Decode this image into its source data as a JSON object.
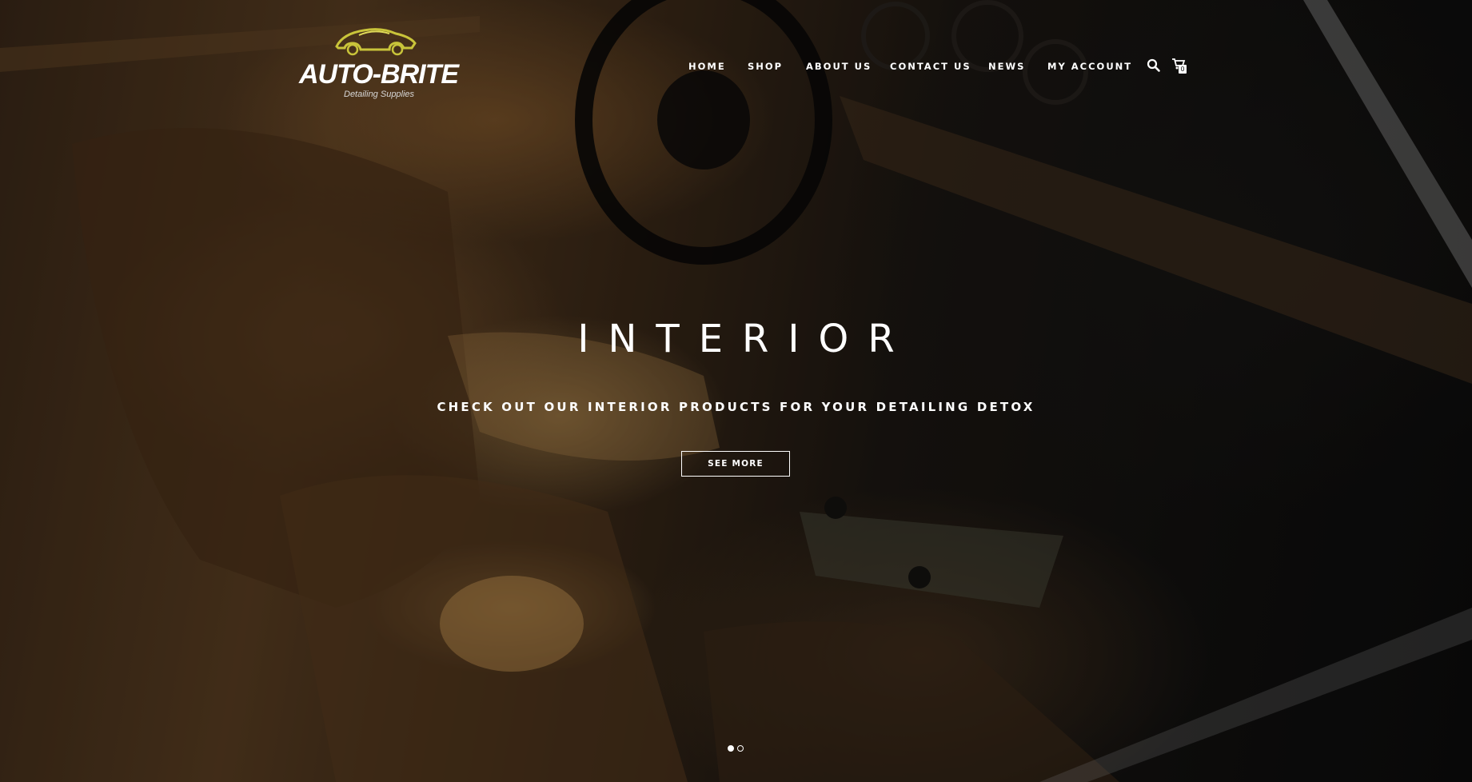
{
  "brand": {
    "name": "AUTO-BRITE",
    "tagline": "Detailing Supplies",
    "accent_color": "#c9c43a"
  },
  "nav": {
    "items": [
      {
        "label": "HOME"
      },
      {
        "label": "SHOP"
      },
      {
        "label": "ABOUT US"
      },
      {
        "label": "CONTACT US"
      },
      {
        "label": "NEWS"
      },
      {
        "label": "MY ACCOUNT"
      }
    ],
    "search_icon": "search-icon",
    "cart_icon": "cart-icon",
    "cart_count": "0"
  },
  "hero": {
    "title": "INTERIOR",
    "subtitle": "CHECK OUT OUR INTERIOR PRODUCTS FOR YOUR DETAILING DETOX",
    "button_label": "SEE MORE",
    "slides_total": 2,
    "active_slide": 1
  }
}
